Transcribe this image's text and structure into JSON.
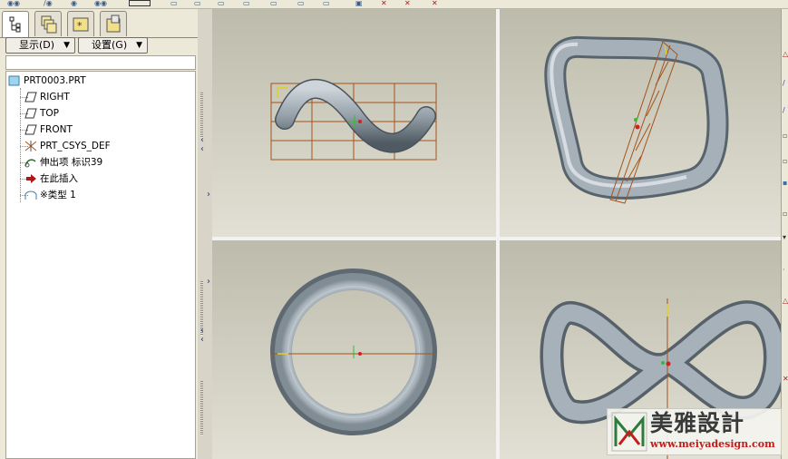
{
  "left_panel": {
    "tabs": [
      {
        "icon": "model-tree-icon",
        "active": true
      },
      {
        "icon": "layers-icon",
        "active": false
      },
      {
        "icon": "favorites-icon",
        "active": false
      },
      {
        "icon": "folder-icon",
        "active": false
      }
    ],
    "show_button": "显示",
    "show_button_key": "(D)",
    "settings_button": "设置",
    "settings_button_key": "(G)",
    "tree": {
      "root": "PRT0003.PRT",
      "items": [
        {
          "label": "RIGHT",
          "icon": "datum-plane-icon"
        },
        {
          "label": "TOP",
          "icon": "datum-plane-icon"
        },
        {
          "label": "FRONT",
          "icon": "datum-plane-icon"
        },
        {
          "label": "PRT_CSYS_DEF",
          "icon": "coordinate-system-icon"
        },
        {
          "label": "伸出项 标识39",
          "icon": "protrusion-icon"
        },
        {
          "label": "在此插入",
          "icon": "insert-here-arrow-icon"
        },
        {
          "label": "※类型 1",
          "icon": "feature-type-icon"
        }
      ]
    }
  },
  "colors": {
    "viewport_top": "#bdbbab",
    "viewport_bottom": "#e2e0d4",
    "datum_orange": "#a5531a",
    "csys_yellow": "#e0d020",
    "tube_shade": "#95a0a9",
    "watermark_red": "#c41c18"
  },
  "watermark": {
    "brand": "美雅設計",
    "url": "www.meiyadesign.com"
  }
}
